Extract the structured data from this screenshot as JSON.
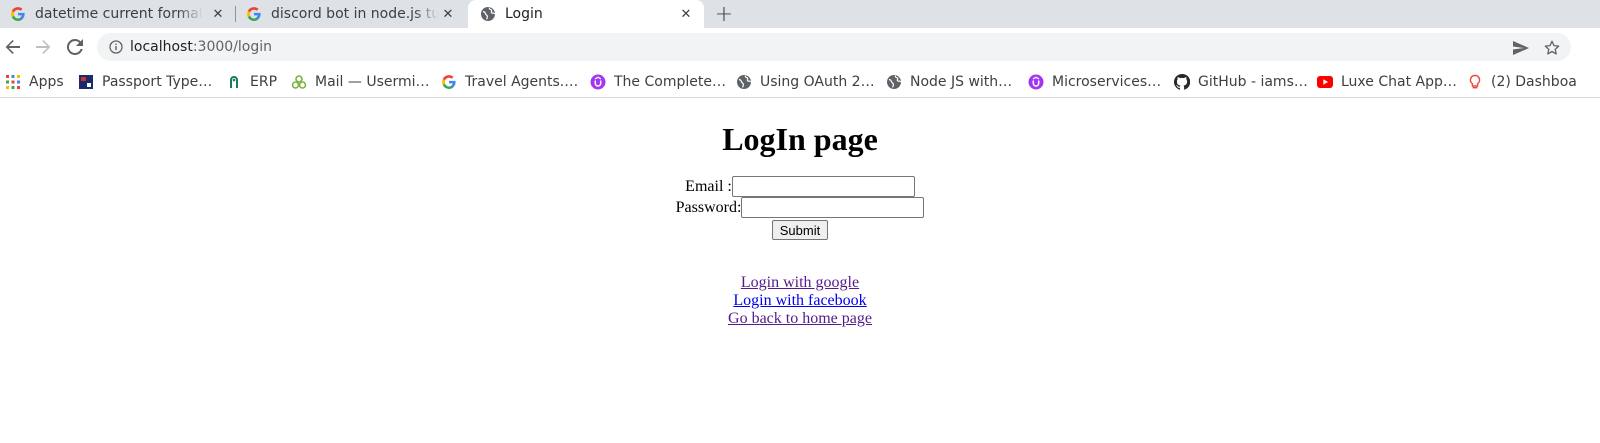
{
  "browser": {
    "tabs": [
      {
        "title": "datetime current format i",
        "favicon": "google-g-icon",
        "active": false
      },
      {
        "title": "discord bot in node.js tuto",
        "favicon": "google-g-icon",
        "active": false
      },
      {
        "title": "Login",
        "favicon": "globe-icon",
        "active": true
      }
    ],
    "new_tab_icon": "plus-icon",
    "address_bar": {
      "host": "localhost",
      "path": ":3000/login"
    },
    "bookmarks": [
      {
        "label": "Apps",
        "icon": "apps-grid-icon"
      },
      {
        "label": "Passport Type…",
        "icon": "passport-icon"
      },
      {
        "label": "ERP",
        "icon": "erp-icon"
      },
      {
        "label": "Mail — Usermi…",
        "icon": "mail-icon"
      },
      {
        "label": "Travel Agents.…",
        "icon": "google-g-icon"
      },
      {
        "label": "The Complete…",
        "icon": "udemy-icon"
      },
      {
        "label": "Using OAuth 2…",
        "icon": "globe-icon"
      },
      {
        "label": "Node JS with…",
        "icon": "globe-icon"
      },
      {
        "label": "Microservices…",
        "icon": "udemy-icon"
      },
      {
        "label": "GitHub - iams…",
        "icon": "github-icon"
      },
      {
        "label": "Luxe Chat App…",
        "icon": "youtube-icon"
      },
      {
        "label": "(2) Dashboa",
        "icon": "bulb-icon"
      }
    ]
  },
  "page": {
    "heading": "LogIn page",
    "email_label": "Email :",
    "email_value": "",
    "password_label": "Password:",
    "password_value": "",
    "submit_label": "Submit",
    "links": {
      "google": "Login with google",
      "facebook": "Login with facebook",
      "home": "Go back to home page"
    }
  },
  "colors": {
    "visited_link": "#551a8b",
    "unvisited_link": "#0000ee",
    "tabstrip_bg": "#dee1e6",
    "omnibox_bg": "#f1f3f4"
  }
}
